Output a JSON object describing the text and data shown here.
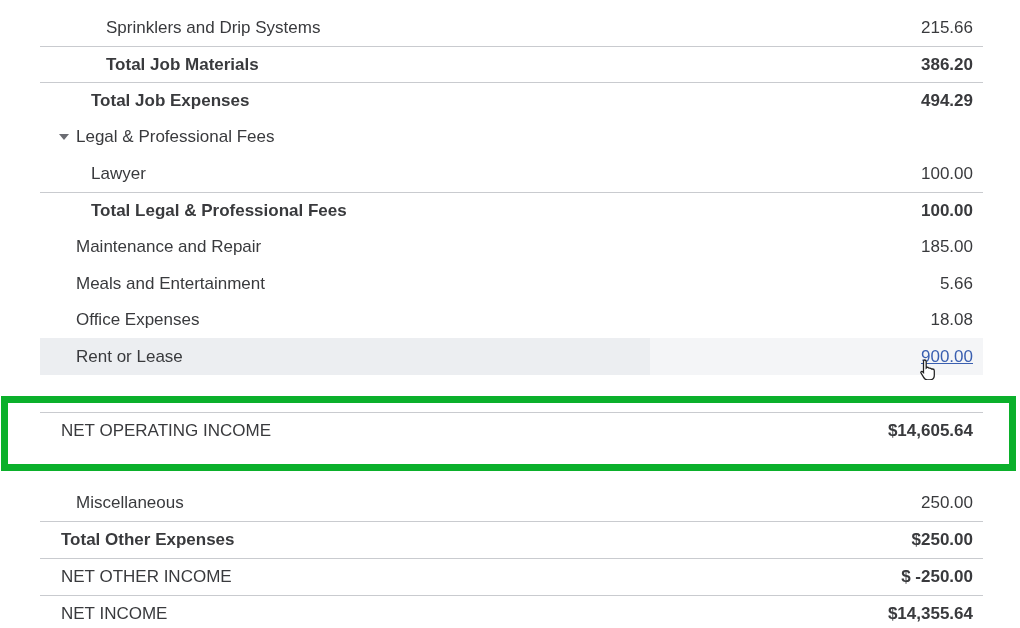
{
  "report_rows": [
    {
      "kind": "group",
      "children": [
        {
          "kind": "group",
          "children": [
            {
              "kind": "group",
              "children": [
                {
                  "kind": "line",
                  "label": "Sprinklers and Drip Systems",
                  "amount": "215.66"
                }
              ],
              "total": {
                "label": "Total Job Materials",
                "amount": "386.20"
              }
            }
          ],
          "total": {
            "label": "Total Job Expenses",
            "amount": "494.29"
          }
        },
        {
          "kind": "group",
          "label": "Legal & Professional Fees",
          "expanded": true,
          "children": [
            {
              "kind": "line",
              "label": "Lawyer",
              "amount": "100.00"
            }
          ],
          "total": {
            "label": "Total Legal & Professional Fees",
            "amount": "100.00"
          }
        },
        {
          "kind": "line",
          "label": "Maintenance and Repair",
          "amount": "185.00"
        },
        {
          "kind": "line",
          "label": "Meals and Entertainment",
          "amount": "5.66"
        },
        {
          "kind": "line",
          "label": "Office Expenses",
          "amount": "18.08"
        },
        {
          "kind": "line",
          "label": "Rent or Lease",
          "amount": "900.00",
          "hovered": true
        }
      ]
    },
    {
      "kind": "blank"
    },
    {
      "kind": "summary",
      "label": "NET OPERATING INCOME",
      "amount": "$14,605.64",
      "highlighted": true
    },
    {
      "kind": "group",
      "children": [
        {
          "kind": "blank"
        },
        {
          "kind": "line",
          "label": "Miscellaneous",
          "amount": "250.00"
        }
      ],
      "total": {
        "label": "Total Other Expenses",
        "amount": "$250.00"
      }
    },
    {
      "kind": "summary",
      "label": "NET OTHER INCOME",
      "amount": "$ -250.00"
    },
    {
      "kind": "summary",
      "label": "NET INCOME",
      "amount": "$14,355.64"
    }
  ]
}
